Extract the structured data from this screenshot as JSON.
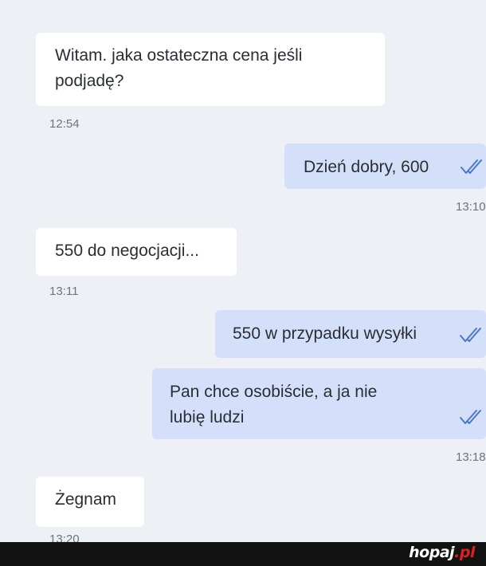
{
  "messages": [
    {
      "side": "incoming",
      "text": "Witam. jaka ostateczna cena jeśli\npodjadę?",
      "time": "12:54"
    },
    {
      "side": "outgoing",
      "text": "Dzień dobry, 600",
      "time": "13:10",
      "status": "read"
    },
    {
      "side": "incoming",
      "text": "550 do negocjacji...",
      "time": "13:11"
    },
    {
      "side": "outgoing",
      "text": "550 w przypadku wysyłki",
      "status": "read"
    },
    {
      "side": "outgoing",
      "text": "Pan chce osobiście, a ja nie\nlubię ludzi",
      "time": "13:18",
      "status": "read"
    },
    {
      "side": "incoming",
      "text": "Żegnam",
      "time": "13:20"
    }
  ],
  "watermark": {
    "name": "hopaj",
    "dot": ".",
    "tld": "pl"
  },
  "colors": {
    "background": "#edf0f4",
    "incoming_bubble": "#ffffff",
    "outgoing_bubble": "#d4e0f9",
    "read_ticks": "#4a78c8"
  },
  "icons": {
    "read_status": "double-check-icon"
  }
}
